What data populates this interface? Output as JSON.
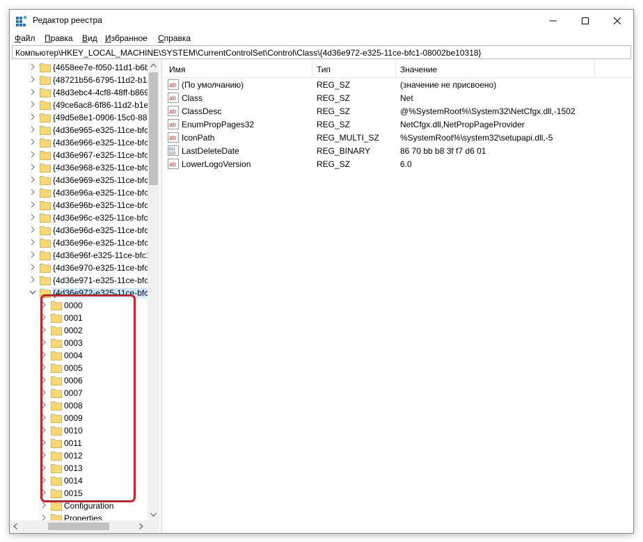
{
  "window": {
    "title": "Редактор реестра"
  },
  "menu": [
    {
      "label": "Файл",
      "ul": "Ф",
      "rest": "айл"
    },
    {
      "label": "Правка",
      "ul": "П",
      "rest": "равка"
    },
    {
      "label": "Вид",
      "ul": "В",
      "rest": "ид"
    },
    {
      "label": "Избранное",
      "ul": "И",
      "rest": "збранное"
    },
    {
      "label": "Справка",
      "ul": "С",
      "rest": "правка"
    }
  ],
  "address": "Компьютер\\HKEY_LOCAL_MACHINE\\SYSTEM\\CurrentControlSet\\Control\\Class\\{4d36e972-e325-11ce-bfc1-08002be10318}",
  "tree": {
    "parent_keys": [
      "{4658ee7e-f050-11d1-b6bd",
      "{48721b56-6795-11d2-b1a8",
      "{48d3ebc4-4cf8-48ff-b869",
      "{49ce6ac8-6f86-11d2-b1e5",
      "{49d5e8e1-0906-15c0-8846",
      "{4d36e965-e325-11ce-bfc1",
      "{4d36e966-e325-11ce-bfc1",
      "{4d36e967-e325-11ce-bfc1",
      "{4d36e968-e325-11ce-bfc1",
      "{4d36e969-e325-11ce-bfc1",
      "{4d36e96a-e325-11ce-bfc1",
      "{4d36e96b-e325-11ce-bfc1",
      "{4d36e96c-e325-11ce-bfc1",
      "{4d36e96d-e325-11ce-bfc1",
      "{4d36e96e-e325-11ce-bfc1",
      "{4d36e96f-e325-11ce-bfc1",
      "{4d36e970-e325-11ce-bfc1",
      "{4d36e971-e325-11ce-bfc1"
    ],
    "selected_key": "{4d36e972-e325-11ce-bfc1",
    "subkeys": [
      "0000",
      "0001",
      "0002",
      "0003",
      "0004",
      "0005",
      "0006",
      "0007",
      "0008",
      "0009",
      "0010",
      "0011",
      "0012",
      "0013",
      "0014",
      "0015",
      "Configuration",
      "Properties"
    ]
  },
  "list": {
    "columns": [
      "Имя",
      "Тип",
      "Значение"
    ],
    "rows": [
      {
        "icon": "string-value-icon",
        "name": "(По умолчанию)",
        "type": "REG_SZ",
        "value": "(значение не присвоено)"
      },
      {
        "icon": "string-value-icon",
        "name": "Class",
        "type": "REG_SZ",
        "value": "Net"
      },
      {
        "icon": "string-value-icon",
        "name": "ClassDesc",
        "type": "REG_SZ",
        "value": "@%SystemRoot%\\System32\\NetCfgx.dll,-1502"
      },
      {
        "icon": "string-value-icon",
        "name": "EnumPropPages32",
        "type": "REG_SZ",
        "value": "NetCfgx.dll,NetPropPageProvider"
      },
      {
        "icon": "string-value-icon",
        "name": "IconPath",
        "type": "REG_MULTI_SZ",
        "value": "%SystemRoot%\\system32\\setupapi.dll,-5"
      },
      {
        "icon": "binary-value-icon",
        "name": "LastDeleteDate",
        "type": "REG_BINARY",
        "value": "86 70 bb b8 3f f7 d6 01"
      },
      {
        "icon": "string-value-icon",
        "name": "LowerLogoVersion",
        "type": "REG_SZ",
        "value": "6.0"
      }
    ]
  },
  "colors": {
    "highlight": "#e8141c",
    "selection": "#cce8ff",
    "folder": "#f8d775"
  }
}
